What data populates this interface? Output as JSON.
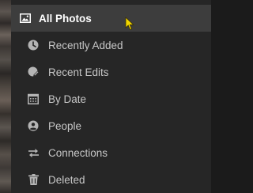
{
  "sidebar": {
    "items": [
      {
        "label": "All Photos",
        "icon": "image-icon",
        "selected": true
      },
      {
        "label": "Recently Added",
        "icon": "clock-icon"
      },
      {
        "label": "Recent Edits",
        "icon": "edit-icon"
      },
      {
        "label": "By Date",
        "icon": "calendar-icon"
      },
      {
        "label": "People",
        "icon": "person-icon"
      },
      {
        "label": "Connections",
        "icon": "sync-icon"
      },
      {
        "label": "Deleted",
        "icon": "trash-icon"
      }
    ]
  },
  "colors": {
    "panel_bg": "#262626",
    "selected_bg": "#3d3d3d",
    "text": "#c7c7c7",
    "selected_text": "#ffffff",
    "cursor": "#f2d600"
  }
}
